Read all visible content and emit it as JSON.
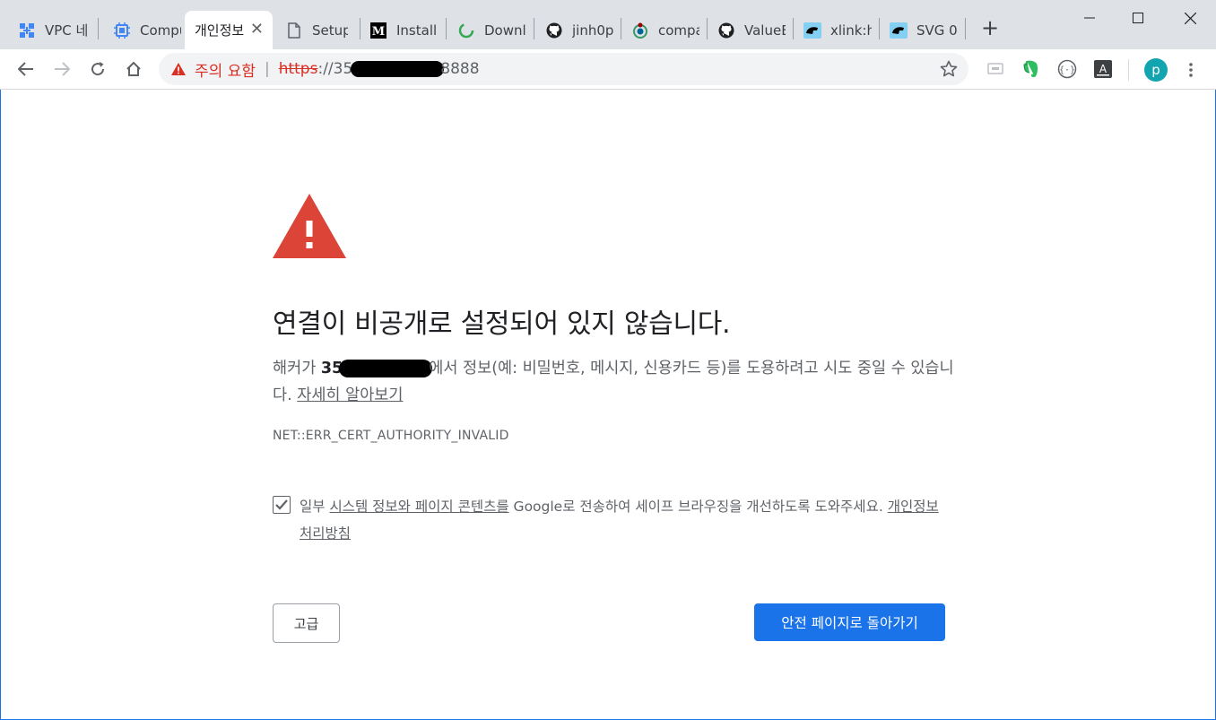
{
  "tabs": [
    {
      "title": "VPC 네",
      "icon": "vpc-network-icon",
      "active": false
    },
    {
      "title": "Compu",
      "icon": "compute-engine-icon",
      "active": false
    },
    {
      "title": "개인정보",
      "icon": "",
      "active": true
    },
    {
      "title": "Setup",
      "icon": "document-icon",
      "active": false
    },
    {
      "title": "Installi",
      "icon": "medium-logo-icon",
      "active": false
    },
    {
      "title": "Downl",
      "icon": "loading-spinner-icon",
      "active": false
    },
    {
      "title": "jinh0p",
      "icon": "github-icon",
      "active": false
    },
    {
      "title": "compa",
      "icon": "wikipedia-icon",
      "active": false
    },
    {
      "title": "ValueE",
      "icon": "github-icon",
      "active": false
    },
    {
      "title": "xlink:h",
      "icon": "mdn-dino-icon",
      "active": false
    },
    {
      "title": "SVG 0",
      "icon": "mdn-dino-icon",
      "active": false
    }
  ],
  "new_tab_label": "+",
  "omnibox": {
    "security_label": "주의 요함",
    "separator": "|",
    "scheme": "https",
    "url_prefix": "://35",
    "url_suffix": "8888"
  },
  "page": {
    "heading": "연결이 비공개로 설정되어 있지 않습니다.",
    "desc_prefix": "해커가 ",
    "desc_host": "35",
    "desc_middle": "에서 정보(예: 비밀번호, 메시지, 신용카드 등)를 도용하려고 시도 중일 수 있습니다. ",
    "learn_more": "자세히 알아보기",
    "error_code": "NET::ERR_CERT_AUTHORITY_INVALID",
    "optin_prefix": "일부 ",
    "optin_link": "시스템 정보와 페이지 콘텐츠를",
    "optin_middle": " Google로 전송하여 세이프 브라우징을 개선하도록 도와주세요. ",
    "privacy_link": "개인정보처리방침",
    "optin_checked": true,
    "advanced_button": "고급",
    "back_button": "안전 페이지로 돌아가기"
  },
  "profile": {
    "initial": "p"
  },
  "colors": {
    "danger": "#d93025",
    "primary": "#1a73e8",
    "avatar": "#12a4af"
  }
}
